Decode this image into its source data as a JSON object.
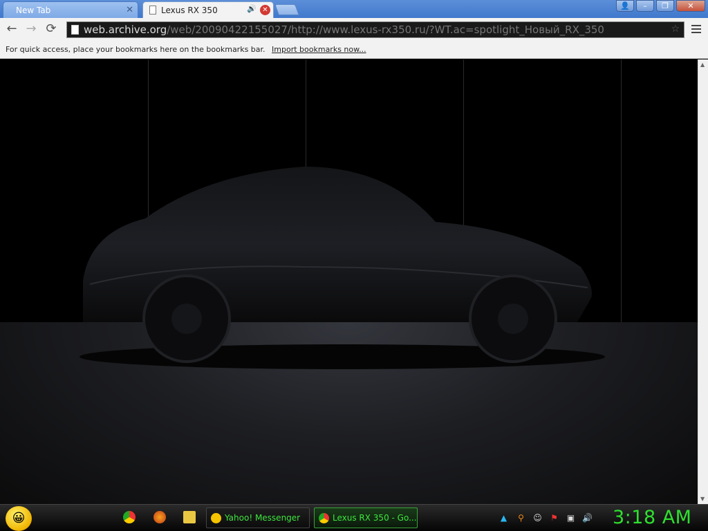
{
  "tabs": [
    {
      "label": "New Tab",
      "active": false
    },
    {
      "label": "Lexus RX 350",
      "active": true
    }
  ],
  "window_controls": {
    "user": "👤",
    "minimize": "–",
    "restore": "❐",
    "close": "✕"
  },
  "toolbar": {
    "back": "←",
    "forward": "→",
    "reload": "⟳"
  },
  "omnibox": {
    "host": "web.archive.org",
    "rest": "/web/20090422155027/http://www.lexus-rx350.ru/?WT.ac=spotlight_Новый_RX_350"
  },
  "bookmarks_bar": {
    "message": "For quick access, place your bookmarks here on the bookmarks bar.",
    "import_link": "Import bookmarks now..."
  },
  "taskbar": {
    "tasks": [
      {
        "label": "Yahoo! Messenger",
        "active": false
      },
      {
        "label": "Lexus RX 350 - Go...",
        "active": true
      }
    ],
    "clock": "3:18 AM"
  },
  "colors": {
    "clock": "#2ee02e",
    "task_text": "#3ee63e",
    "tab_strip": "#4a82d2"
  }
}
